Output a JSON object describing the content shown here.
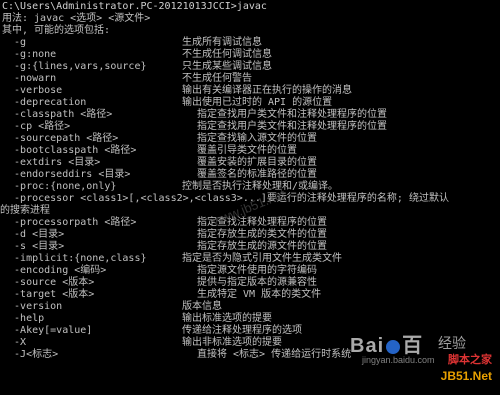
{
  "prompt": "C:\\Users\\Administrator.PC-20121013JCCI>javac",
  "usage": "用法: javac <选项> <源文件>",
  "intro": "其中, 可能的选项包括:",
  "options": [
    {
      "opt": "  -g",
      "desc": "生成所有调试信息"
    },
    {
      "opt": "  -g:none",
      "desc": "不生成任何调试信息"
    },
    {
      "opt": "  -g:{lines,vars,source}",
      "desc": "只生成某些调试信息"
    },
    {
      "opt": "  -nowarn",
      "desc": "不生成任何警告"
    },
    {
      "opt": "  -verbose",
      "desc": "输出有关编译器正在执行的操作的消息"
    },
    {
      "opt": "  -deprecation",
      "desc": "输出使用已过时的 API 的源位置"
    },
    {
      "opt": "  -classpath <路径>",
      "desc": "指定查找用户类文件和注释处理程序的位置"
    },
    {
      "opt": "  -cp <路径>",
      "desc": "指定查找用户类文件和注释处理程序的位置"
    },
    {
      "opt": "  -sourcepath <路径>",
      "desc": "指定查找输入源文件的位置"
    },
    {
      "opt": "  -bootclasspath <路径>",
      "desc": "覆盖引导类文件的位置"
    },
    {
      "opt": "  -extdirs <目录>",
      "desc": "覆盖安装的扩展目录的位置"
    },
    {
      "opt": "  -endorseddirs <目录>",
      "desc": "覆盖签名的标准路径的位置"
    },
    {
      "opt": "  -proc:{none,only}",
      "desc": "控制是否执行注释处理和/或编译。"
    },
    {
      "opt": "  -processor <class1>[,<class2>,<class3>...]要运行的注释处理程序的名称; 绕过默认",
      "desc": ""
    },
    {
      "opt": "的搜索进程",
      "desc": ""
    },
    {
      "opt": "  -processorpath <路径>",
      "desc": "指定查找注释处理程序的位置"
    },
    {
      "opt": "  -d <目录>",
      "desc": "指定存放生成的类文件的位置"
    },
    {
      "opt": "  -s <目录>",
      "desc": "指定存放生成的源文件的位置"
    },
    {
      "opt": "  -implicit:{none,class}",
      "desc": "指定是否为隐式引用文件生成类文件"
    },
    {
      "opt": "  -encoding <编码>",
      "desc": "指定源文件使用的字符编码"
    },
    {
      "opt": "  -source <版本>",
      "desc": "提供与指定版本的源兼容性"
    },
    {
      "opt": "  -target <版本>",
      "desc": "生成特定 VM 版本的类文件"
    },
    {
      "opt": "  -version",
      "desc": "版本信息"
    },
    {
      "opt": "  -help",
      "desc": "输出标准选项的提要"
    },
    {
      "opt": "  -Akey[=value]",
      "desc": "传递给注释处理程序的选项"
    },
    {
      "opt": "  -X",
      "desc": "输出非标准选项的提要"
    },
    {
      "opt": "  -J<标志>",
      "desc": "直接将 <标志> 传递给运行时系统"
    }
  ],
  "watermark": {
    "logo": "Bai",
    "logo2": "百",
    "cn": "经验",
    "sub": "jingyan.baidu.com",
    "site": "脚本之家",
    "site2": "JB51.Net",
    "center": "www.jb51.net"
  }
}
